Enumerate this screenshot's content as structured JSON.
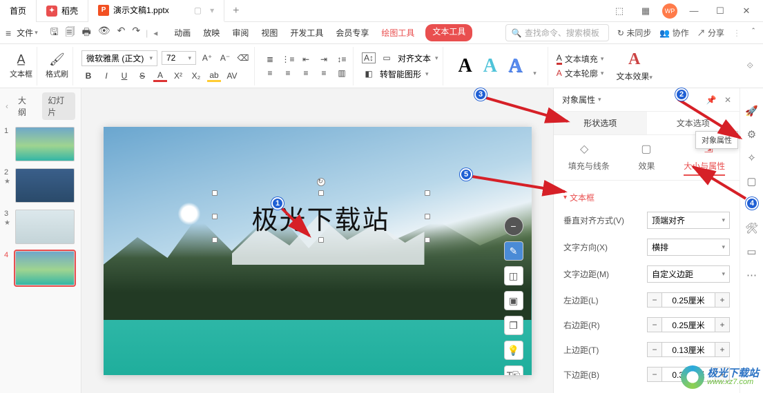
{
  "titlebar": {
    "home": "首页",
    "doke": "稻壳",
    "doc": "演示文稿1.pptx",
    "layout_mode": "⬚",
    "grid_mode": "▦"
  },
  "menubar": {
    "file": "文件",
    "tabs": [
      "动画",
      "放映",
      "审阅",
      "视图",
      "开发工具",
      "会员专享"
    ],
    "ctx1": "绘图工具",
    "ctx2": "文本工具",
    "search_placeholder": "查找命令、搜索模板",
    "unsync": "未同步",
    "collab": "协作",
    "share": "分享"
  },
  "ribbon": {
    "textbox": "文本框",
    "format_painter": "格式刷",
    "font_name": "微软雅黑 (正文)",
    "font_size": "72",
    "align_label": "对齐文本",
    "smart_label": "转智能图形",
    "fill": "文本填充",
    "outline": "文本轮廓",
    "effects": "文本效果"
  },
  "thumbs": {
    "outline": "大纲",
    "slides": "幻灯片",
    "items": [
      {
        "n": "1"
      },
      {
        "n": "2"
      },
      {
        "n": "3"
      },
      {
        "n": "4"
      }
    ]
  },
  "canvas": {
    "textbox_text": "极光下载站"
  },
  "panel": {
    "title": "对象属性",
    "tab_shape": "形状选项",
    "tab_text": "文本选项",
    "sub_fill": "填充与线条",
    "sub_effect": "效果",
    "sub_size": "大小与属性",
    "tooltip": "对象属性",
    "section_textbox": "文本框",
    "valign_label": "垂直对齐方式(V)",
    "valign_value": "顶端对齐",
    "dir_label": "文字方向(X)",
    "dir_value": "横排",
    "margin_label": "文字边距(M)",
    "margin_value": "自定义边距",
    "left_label": "左边距(L)",
    "left_value": "0.25厘米",
    "right_label": "右边距(R)",
    "right_value": "0.25厘米",
    "top_label": "上边距(T)",
    "top_value": "0.13厘米",
    "bottom_label": "下边距(B)",
    "bottom_value": "0.30厘米"
  },
  "badges": {
    "b1": "1",
    "b2": "2",
    "b3": "3",
    "b4": "4",
    "b5": "5"
  },
  "watermark": {
    "t1": "极光下载站",
    "t2": "www.xz7.com"
  }
}
